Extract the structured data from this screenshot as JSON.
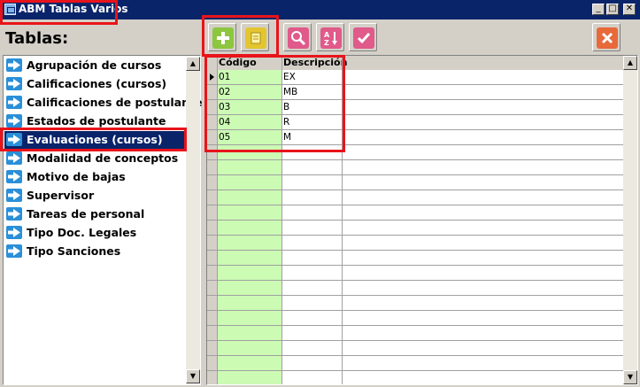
{
  "window": {
    "title": "ABM Tablas Varios"
  },
  "heading": "Tablas:",
  "controls": {
    "minimize": "_",
    "maximize": "□",
    "close": "✕"
  },
  "toolbar": {
    "buttons": [
      {
        "name": "add-button",
        "icon": "plus-icon",
        "color": "#8dc63f"
      },
      {
        "name": "edit-button",
        "icon": "edit-icon",
        "color": "#e3c530"
      },
      {
        "name": "search-button",
        "icon": "magnifier-icon",
        "color": "#e05a8a"
      },
      {
        "name": "sort-button",
        "icon": "sort-az-icon",
        "color": "#e05a8a"
      },
      {
        "name": "export-button",
        "icon": "checkmark-icon",
        "color": "#e05a8a"
      },
      {
        "name": "close-button",
        "icon": "close-x-icon",
        "color": "#e8693a"
      }
    ]
  },
  "tables": {
    "selected_index": 4,
    "items": [
      "Agrupación de cursos",
      "Calificaciones (cursos)",
      "Calificaciones de postulante",
      "Estados de postulante",
      "Evaluaciones (cursos)",
      "Modalidad de conceptos",
      "Motivo de bajas",
      "Supervisor",
      "Tareas de personal",
      "Tipo Doc. Legales",
      "Tipo Sanciones"
    ]
  },
  "grid": {
    "columns": [
      "Código",
      "Descripción"
    ],
    "rows": [
      {
        "codigo": "01",
        "descripcion": "EX"
      },
      {
        "codigo": "02",
        "descripcion": "MB"
      },
      {
        "codigo": "03",
        "descripcion": "B"
      },
      {
        "codigo": "04",
        "descripcion": "R"
      },
      {
        "codigo": "05",
        "descripcion": "M"
      }
    ],
    "total_visible_rows": 21
  },
  "colors": {
    "titlebar": "#0a246a",
    "highlight": "#e8141a",
    "code_column": "#ccfbb4"
  }
}
